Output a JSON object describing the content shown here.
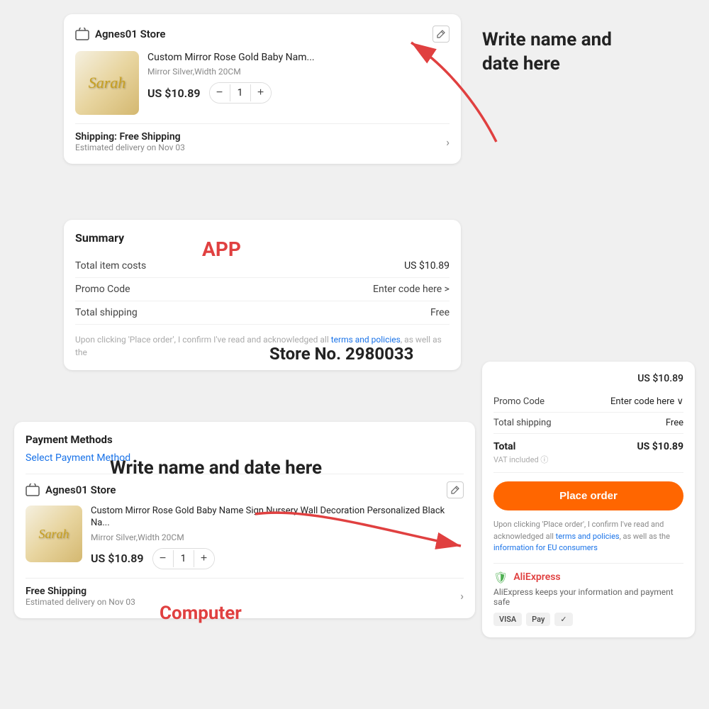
{
  "app": {
    "store1": {
      "name": "Agnes01 Store",
      "product_title": "Custom Mirror Rose Gold Baby Nam...",
      "product_variant": "Mirror Silver,Width 20CM",
      "price": "US $10.89",
      "qty": "1",
      "shipping_label": "Shipping: Free Shipping",
      "shipping_detail": "Estimated delivery on Nov 03"
    },
    "summary": {
      "title": "Summary",
      "total_item_label": "Total item costs",
      "total_item_value": "US $10.89",
      "promo_label": "Promo Code",
      "promo_value": "Enter code here >",
      "shipping_label": "Total shipping",
      "shipping_value": "Free",
      "terms_text": "Upon clicking 'Place order', I confirm I've read and acknowledged all ",
      "terms_link": "terms and policies",
      "terms_end": ", as well as the"
    },
    "label": "APP"
  },
  "annotation": {
    "top_text": "Write name and\ndate here",
    "bottom_text": "Write name and date here"
  },
  "store_no": "Store No. 2980033",
  "payment": {
    "title": "Payment Methods",
    "method_link": "Select Payment Method",
    "store2_name": "Agnes01 Store",
    "product2_title": "Custom Mirror Rose Gold Baby Name Sign Nursery Wall Decoration Personalized Black Na...",
    "product2_variant": "Mirror Silver,Width 20CM",
    "product2_price": "US $10.89",
    "qty2": "1",
    "shipping2_label": "Free Shipping",
    "shipping2_detail": "Estimated delivery on Nov 03"
  },
  "order_summary": {
    "item_total": "US $10.89",
    "promo_label": "Promo Code",
    "promo_value": "Enter code here ∨",
    "shipping_label": "Total shipping",
    "shipping_value": "Free",
    "total_label": "Total",
    "total_value": "US $10.89",
    "vat_text": "VAT included ⓘ",
    "place_order": "Place order",
    "terms1": "Upon clicking 'Place order', I confirm I've read and acknowledged all ",
    "terms_link": "terms and policies",
    "terms2": ", as well as the ",
    "terms_link2": "information for EU consumers",
    "aliexpress_name": "AliExpress",
    "aliexpress_safe": "AliExpress keeps your information and payment safe",
    "icon1": "VISA",
    "icon2": "Pay",
    "icon3": "✓"
  },
  "computer_label": "Computer"
}
